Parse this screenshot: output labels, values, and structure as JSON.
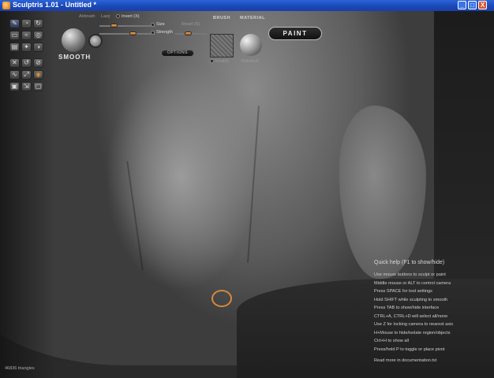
{
  "window": {
    "title": "Sculptris 1.01 - Untitled *",
    "minimize_glyph": "_",
    "maximize_glyph": "□",
    "close_glyph": "X"
  },
  "toolbar": {
    "brush_name": "SMOOTH",
    "options": {
      "airbrush_label": "Airbrush",
      "lazy_label": "Lazy",
      "invert_label": "Invert (X)",
      "size_label": "Size",
      "reset_label": "Reset (S)",
      "strength_label": "Strength",
      "options_button": "OPTIONS"
    },
    "brush_section": "BRUSH",
    "brush_texture_toggle": "Enable",
    "material_section": "MATERIAL",
    "material_name": "00default",
    "paint_button": "PAINT",
    "tool_glyphs": [
      "✎",
      "◔",
      "↻",
      "▭",
      "≈",
      "◎",
      "▤",
      "✦",
      "◑",
      "✕",
      "↺",
      "⊘",
      "∿",
      "⤢",
      "◉",
      "▣",
      "⇲",
      "▢"
    ]
  },
  "help": {
    "title": "Quick help (F1 to show/hide)",
    "lines": [
      "Use mouse buttons to sculpt or paint",
      "Middle mouse or ALT to control camera",
      "Press SPACE for tool settings",
      "Hold SHIFT while sculpting to smooth",
      "Press TAB to show/hide interface",
      "CTRL+A, CTRL+D will select all/none",
      "Use Z for locking camera to nearest axis",
      "H+Mouse to hide/isolate region/objects",
      "Ctrl+H to show all",
      "Press/hold P to toggle or place pivot"
    ],
    "footer": "Read more in documentation.txt"
  },
  "status": {
    "triangles": "46836 triangles"
  },
  "colors": {
    "titlebar": "#1a47b8",
    "accent_orange": "#d58a3c"
  }
}
